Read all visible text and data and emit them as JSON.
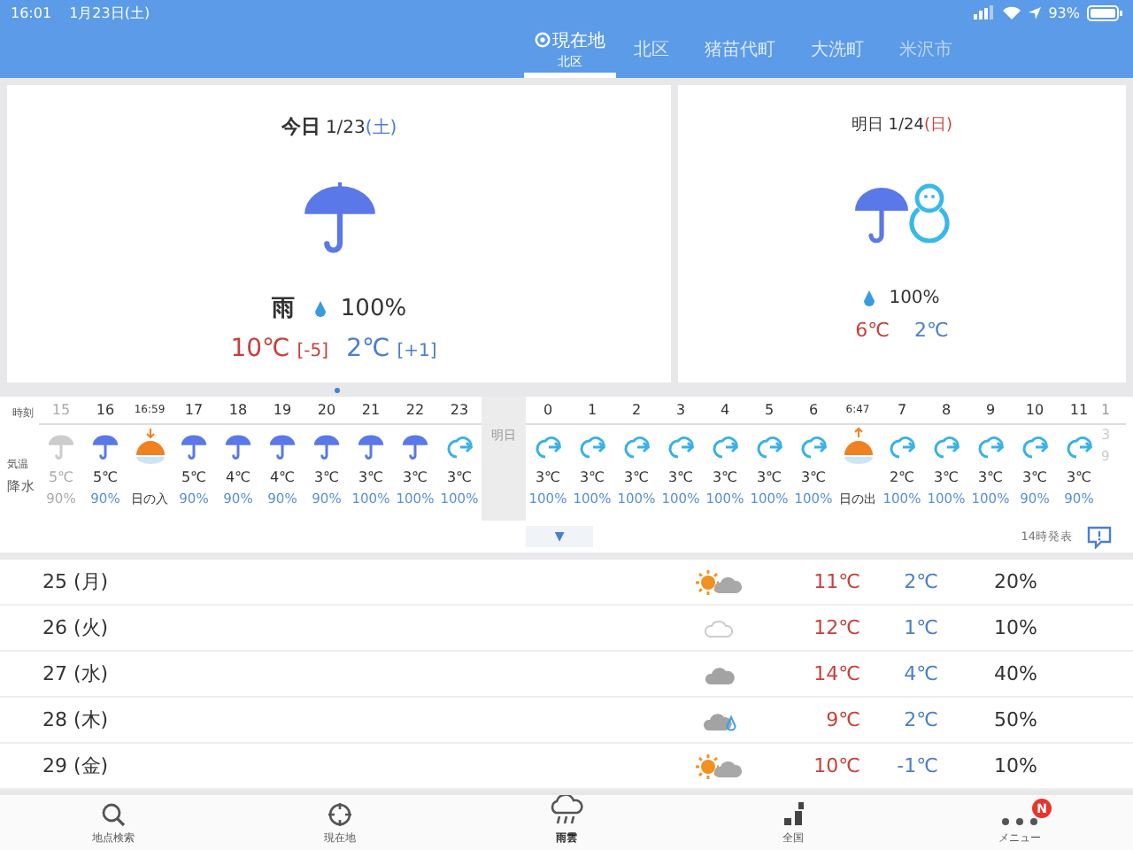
{
  "status_bar": {
    "time": "16:01",
    "date": "1月23日(土)",
    "battery": "93%"
  },
  "tabs": [
    {
      "label": "現在地",
      "sub": "北区",
      "selected": true,
      "faded": false
    },
    {
      "label": "北区",
      "selected": false,
      "faded": false
    },
    {
      "label": "猪苗代町",
      "selected": false,
      "faded": false
    },
    {
      "label": "大洗町",
      "selected": false,
      "faded": false
    },
    {
      "label": "米沢市",
      "selected": false,
      "faded": true
    }
  ],
  "today": {
    "label": "今日",
    "date": "1/23",
    "day": "(土)",
    "color": "#4a7fd0",
    "weather": "雨",
    "precip": "100%",
    "high": "10℃",
    "high_diff": "[-5]",
    "low": "2℃",
    "low_diff": "[+1]"
  },
  "tomorrow": {
    "label": "明日",
    "date": "1/24",
    "day": "(日)",
    "color": "#d04040",
    "precip": "100%",
    "high": "6℃",
    "low": "2℃"
  },
  "hourly": {
    "row_labels": [
      "時刻",
      "気温",
      "降水"
    ],
    "columns": [
      {
        "kind": "rain",
        "time": "15",
        "temp": "5℃",
        "precip": "90%",
        "past": true
      },
      {
        "kind": "rain",
        "time": "16",
        "temp": "5℃",
        "precip": "90%",
        "past": false
      },
      {
        "kind": "sunset",
        "time": "16:59",
        "text": "日の入"
      },
      {
        "kind": "rain",
        "time": "17",
        "temp": "5℃",
        "precip": "90%",
        "past": false
      },
      {
        "kind": "rain",
        "time": "18",
        "temp": "4℃",
        "precip": "90%",
        "past": false
      },
      {
        "kind": "rain",
        "time": "19",
        "temp": "4℃",
        "precip": "90%",
        "past": false
      },
      {
        "kind": "rain",
        "time": "20",
        "temp": "3℃",
        "precip": "90%",
        "past": false
      },
      {
        "kind": "rain",
        "time": "21",
        "temp": "3℃",
        "precip": "100%",
        "past": false
      },
      {
        "kind": "rain",
        "time": "22",
        "temp": "3℃",
        "precip": "100%",
        "past": false
      },
      {
        "kind": "sleet",
        "time": "23",
        "temp": "3℃",
        "precip": "100%",
        "past": false
      },
      {
        "kind": "divider",
        "text": "明日"
      },
      {
        "kind": "sleet",
        "time": "0",
        "temp": "3℃",
        "precip": "100%",
        "past": false
      },
      {
        "kind": "sleet",
        "time": "1",
        "temp": "3℃",
        "precip": "100%",
        "past": false
      },
      {
        "kind": "sleet",
        "time": "2",
        "temp": "3℃",
        "precip": "100%",
        "past": false
      },
      {
        "kind": "sleet",
        "time": "3",
        "temp": "3℃",
        "precip": "100%",
        "past": false
      },
      {
        "kind": "sleet",
        "time": "4",
        "temp": "3℃",
        "precip": "100%",
        "past": false
      },
      {
        "kind": "sleet",
        "time": "5",
        "temp": "3℃",
        "precip": "100%",
        "past": false
      },
      {
        "kind": "sleet",
        "time": "6",
        "temp": "3℃",
        "precip": "100%",
        "past": false
      },
      {
        "kind": "sunrise",
        "time": "6:47",
        "text": "日の出"
      },
      {
        "kind": "sleet",
        "time": "7",
        "temp": "2℃",
        "precip": "100%",
        "past": false
      },
      {
        "kind": "sleet",
        "time": "8",
        "temp": "3℃",
        "precip": "100%",
        "past": false
      },
      {
        "kind": "sleet",
        "time": "9",
        "temp": "3℃",
        "precip": "100%",
        "past": false
      },
      {
        "kind": "sleet",
        "time": "10",
        "temp": "3℃",
        "precip": "90%",
        "past": false
      },
      {
        "kind": "sleet",
        "time": "11",
        "temp": "3℃",
        "precip": "90%",
        "past": false
      },
      {
        "kind": "partial",
        "time": "1",
        "temp": "3",
        "precip": "9"
      }
    ],
    "issued": "14時発表",
    "expand": "▼"
  },
  "daily": [
    {
      "date": "25 (月)",
      "kind": "sun-cloud",
      "high": "11℃",
      "low": "2℃",
      "precip": "20%"
    },
    {
      "date": "26 (火)",
      "kind": "cloud-light",
      "high": "12℃",
      "low": "1℃",
      "precip": "10%"
    },
    {
      "date": "27 (水)",
      "kind": "cloud",
      "high": "14℃",
      "low": "4℃",
      "precip": "40%"
    },
    {
      "date": "28 (木)",
      "kind": "cloud-rain",
      "high": "9℃",
      "low": "2℃",
      "precip": "50%"
    },
    {
      "date": "29 (金)",
      "kind": "sun-cloud",
      "high": "10℃",
      "low": "-1℃",
      "precip": "10%"
    }
  ],
  "bottom_nav": [
    {
      "kind": "search",
      "label": "地点検索",
      "selected": false
    },
    {
      "kind": "location",
      "label": "現在地",
      "selected": false
    },
    {
      "kind": "radar",
      "label": "雨雲",
      "selected": true
    },
    {
      "kind": "map",
      "label": "全国",
      "selected": false
    },
    {
      "kind": "menu",
      "label": "メニュー",
      "badge": "N",
      "selected": false
    }
  ]
}
